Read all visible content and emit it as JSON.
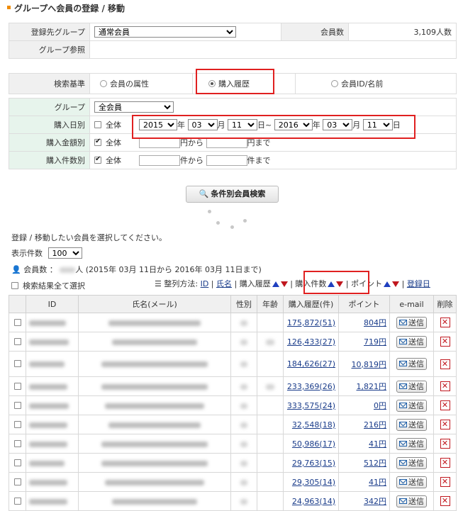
{
  "page": {
    "title": "グループへ会員の登録 / 移動"
  },
  "target": {
    "group_label": "登録先グループ",
    "group_value": "通常会員",
    "member_count_label": "会員数",
    "member_count_value": "3,109人数",
    "group_ref_label": "グループ参照"
  },
  "criteria": {
    "label": "検索基準",
    "options": [
      "会員の属性",
      "購入履歴",
      "会員ID/名前"
    ],
    "selected": "購入履歴"
  },
  "filters": {
    "group_label": "グループ",
    "group_value": "全会員",
    "date_label": "購入日別",
    "all_label": "全体",
    "from_year": "2015",
    "from_month": "03",
    "from_day": "11",
    "to_year": "2016",
    "to_month": "03",
    "to_day": "11",
    "year_unit": "年",
    "month_unit": "月",
    "day_unit": "日",
    "tilde": "~",
    "amount_label": "購入金額別",
    "amount_from": "円から",
    "amount_to": "円まで",
    "count_label": "購入件数別",
    "count_from": "件から",
    "count_to": "件まで"
  },
  "search_button": "条件別会員検索",
  "instruction": "登録 / 移動したい会員を選択してください。",
  "display_count": {
    "label": "表示件数",
    "value": "100"
  },
  "member_summary": {
    "label": "会員数 ：",
    "range": "人 (2015年 03月 11日から 2016年 03月 11日まで)"
  },
  "select_all_label": "検索結果全て選択",
  "sort": {
    "label": "整列方法:",
    "options": [
      "ID",
      "氏名",
      "購入履歴",
      "購入件数",
      "ポイント",
      "登録日"
    ]
  },
  "table": {
    "headers": [
      "ID",
      "氏名(メール)",
      "性別",
      "年齢",
      "購入履歴(件)",
      "ポイント",
      "e-mail",
      "削除"
    ],
    "send_label": "送信",
    "delete_glyph": "✕",
    "rows": [
      {
        "history": "175,872(51)",
        "point": "804円"
      },
      {
        "history": "126,433(27)",
        "point": "719円"
      },
      {
        "history": "184,626(27)",
        "point": "10,819円"
      },
      {
        "history": "233,369(26)",
        "point": "1,821円"
      },
      {
        "history": "333,575(24)",
        "point": "0円"
      },
      {
        "history": "32,548(18)",
        "point": "216円"
      },
      {
        "history": "50,986(17)",
        "point": "41円"
      },
      {
        "history": "29,763(15)",
        "point": "512円"
      },
      {
        "history": "29,305(14)",
        "point": "41円"
      },
      {
        "history": "24,963(14)",
        "point": "342円"
      }
    ]
  },
  "colors": {
    "accent_orange": "#f08c00",
    "link_blue": "#1a3c8a",
    "highlight_red": "#e02020",
    "label_green": "#e7f4ec",
    "label_gray": "#f0f0f0"
  }
}
